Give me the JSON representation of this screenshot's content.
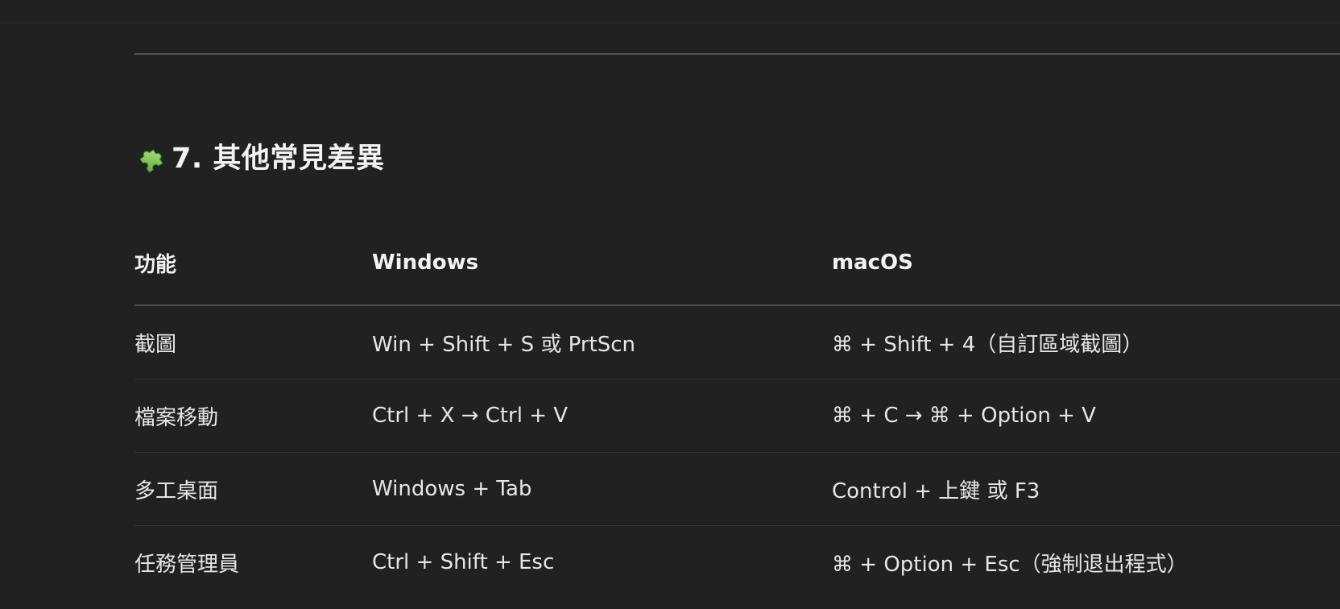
{
  "section": {
    "icon": "puzzle-piece-icon",
    "title": "7. 其他常見差異"
  },
  "table": {
    "headers": [
      "功能",
      "Windows",
      "macOS"
    ],
    "rows": [
      [
        "截圖",
        "Win + Shift + S 或 PrtScn",
        "⌘ + Shift + 4（自訂區域截圖）"
      ],
      [
        "檔案移動",
        "Ctrl + X → Ctrl + V",
        "⌘ + C → ⌘ + Option + V"
      ],
      [
        "多工桌面",
        "Windows + Tab",
        "Control + 上鍵 或 F3"
      ],
      [
        "任務管理員",
        "Ctrl + Shift + Esc",
        "⌘ + Option + Esc（強制退出程式）"
      ]
    ]
  },
  "colors": {
    "background": "#212121",
    "text": "#e6e6e6",
    "divider": "#555555",
    "icon_green": "#7cc24a"
  }
}
